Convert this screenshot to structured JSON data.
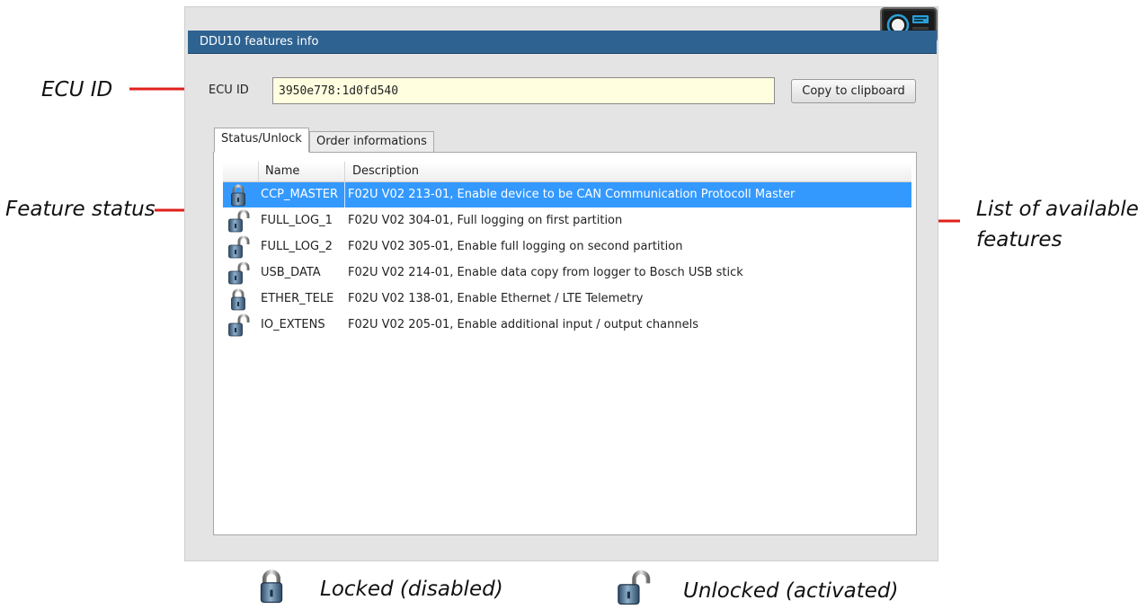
{
  "window": {
    "title": "DDU10 features info"
  },
  "ecu": {
    "label": "ECU ID",
    "value": "3950e778:1d0fd540",
    "copy_button": "Copy to clipboard"
  },
  "tabs": [
    {
      "label": "Status/Unlock",
      "active": true
    },
    {
      "label": "Order informations",
      "active": false
    }
  ],
  "table": {
    "columns": [
      "Name",
      "Description"
    ],
    "rows": [
      {
        "name": "CCP_MASTER",
        "description": "F02U V02 213-01, Enable device to be CAN Communication Protocoll Master",
        "status": "locked",
        "selected": true
      },
      {
        "name": "FULL_LOG_1",
        "description": "F02U V02 304-01, Full logging on first partition",
        "status": "unlocked",
        "selected": false
      },
      {
        "name": "FULL_LOG_2",
        "description": "F02U V02 305-01, Enable full logging on second partition",
        "status": "unlocked",
        "selected": false
      },
      {
        "name": "USB_DATA",
        "description": "F02U V02 214-01, Enable data copy from logger to Bosch USB stick",
        "status": "unlocked",
        "selected": false
      },
      {
        "name": "ETHER_TELE",
        "description": "F02U V02 138-01, Enable Ethernet / LTE Telemetry",
        "status": "locked",
        "selected": false
      },
      {
        "name": "IO_EXTENS",
        "description": "F02U V02 205-01, Enable additional input / output channels",
        "status": "unlocked",
        "selected": false
      }
    ]
  },
  "annotations": {
    "ecu_id": "ECU ID",
    "feature_status": "Feature status",
    "list_line1": "List of available",
    "list_line2": "features",
    "arrow_color": "#e0201b"
  },
  "legend": {
    "locked": "Locked (disabled)",
    "unlocked": "Unlocked (activated)"
  },
  "colors": {
    "titlebar": "#2e6391",
    "selection": "#3399ff",
    "ecu_field": "#ffffe0"
  }
}
